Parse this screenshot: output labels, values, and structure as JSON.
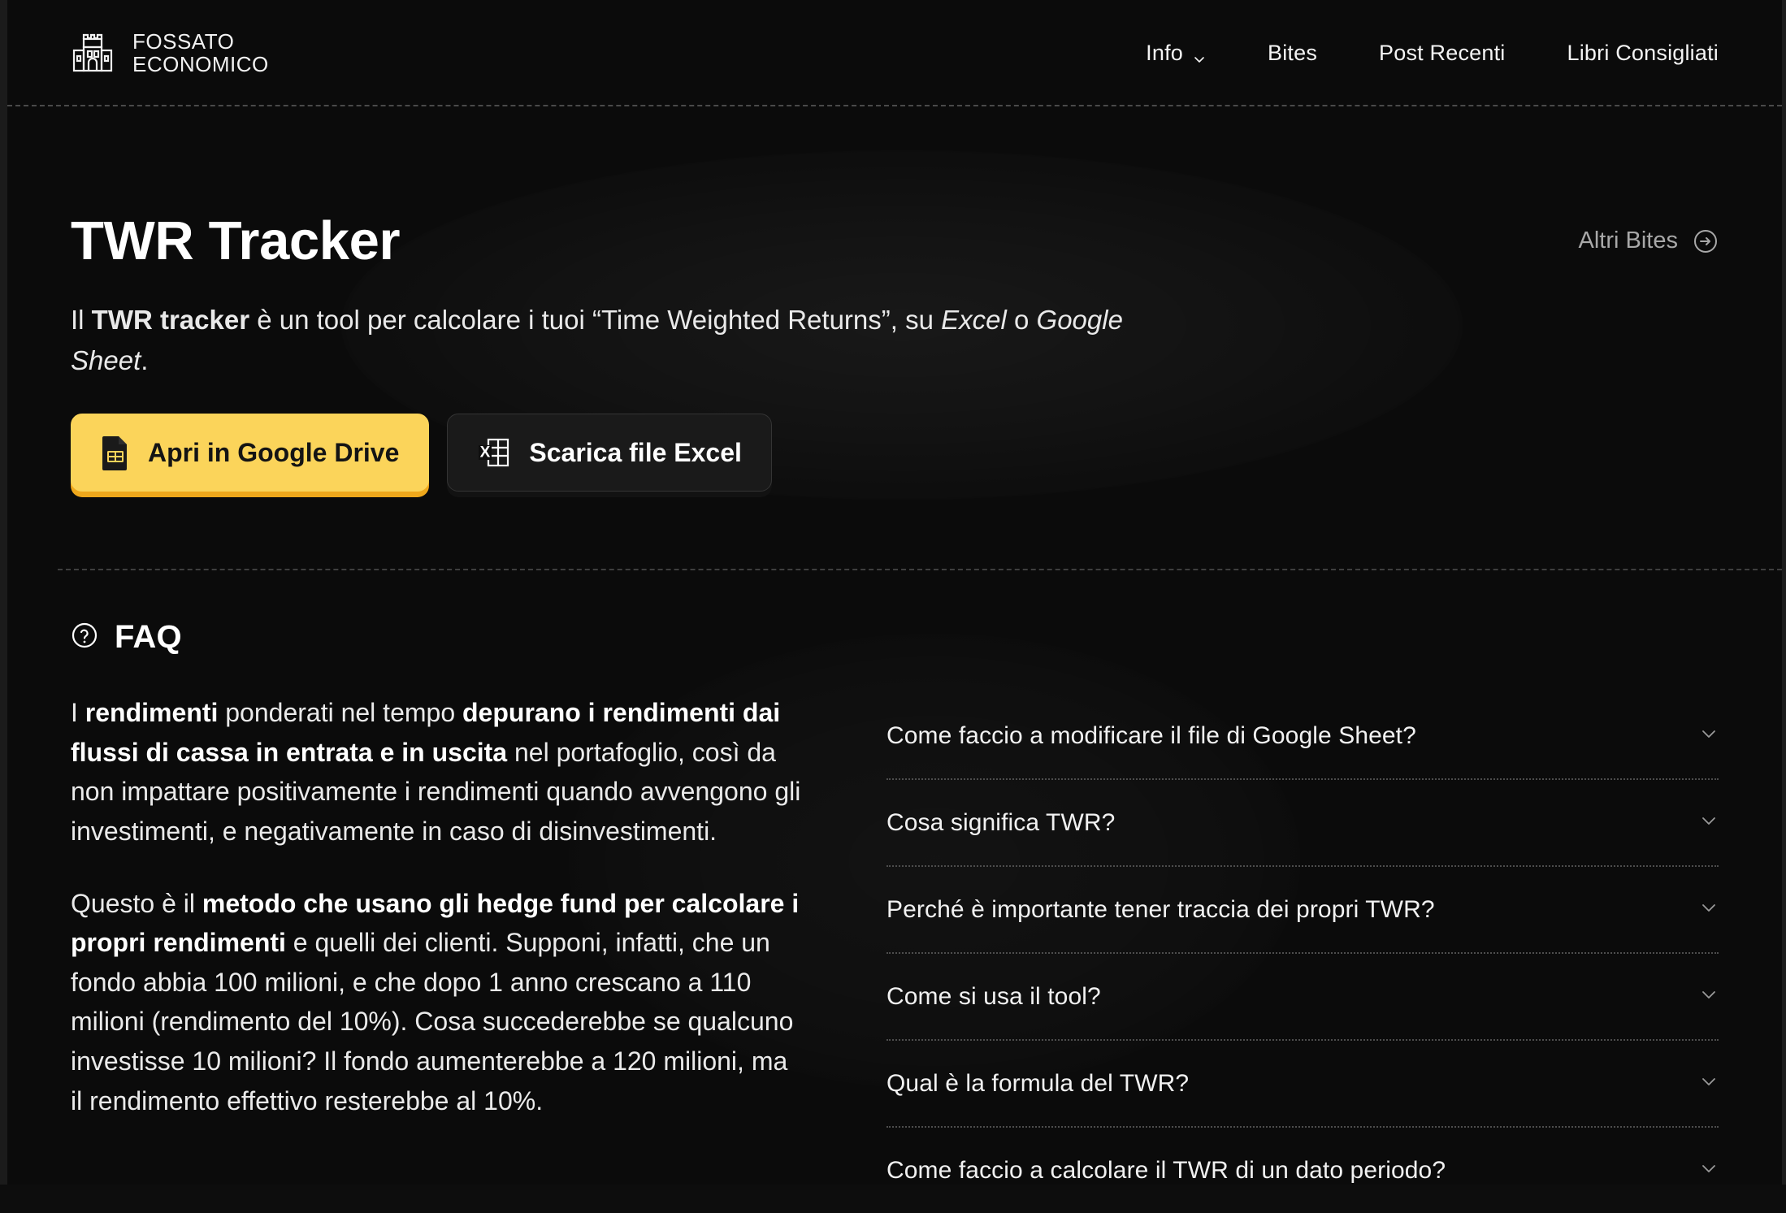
{
  "header": {
    "brand": {
      "line1": "FOSSATO",
      "line2": "ECONOMICO",
      "logo_icon": "castle-icon"
    },
    "nav": [
      {
        "label": "Info",
        "has_dropdown": true,
        "icon": "chevron-down-icon"
      },
      {
        "label": "Bites",
        "has_dropdown": false
      },
      {
        "label": "Post Recenti",
        "has_dropdown": false
      },
      {
        "label": "Libri Consigliati",
        "has_dropdown": false
      }
    ]
  },
  "hero": {
    "title": "TWR Tracker",
    "altri_bites": {
      "label": "Altri Bites",
      "icon": "arrow-right-circle-icon"
    },
    "description": {
      "part1": "Il ",
      "bold1": "TWR tracker",
      "part2": " è un tool per calcolare i tuoi “Time Weighted Returns”, su ",
      "italic1": "Excel",
      "part3": " o ",
      "italic2": "Google Sheet",
      "part4": "."
    },
    "buttons": [
      {
        "label": "Apri in Google Drive",
        "icon": "google-sheets-file-icon",
        "style": "primary-yellow"
      },
      {
        "label": "Scarica file Excel",
        "icon": "excel-file-icon",
        "style": "secondary-dark"
      }
    ]
  },
  "faq": {
    "heading": "FAQ",
    "heading_icon": "question-circle-icon",
    "paragraphs": [
      {
        "segments": [
          {
            "text": "I ",
            "bold": false
          },
          {
            "text": "rendimenti",
            "bold": true
          },
          {
            "text": " ponderati nel tempo ",
            "bold": false
          },
          {
            "text": "depurano i rendimenti dai flussi di cassa in entrata e in uscita",
            "bold": true
          },
          {
            "text": " nel portafoglio, così da non impattare positivamente i rendimenti quando avvengono gli investimenti, e negativamente in caso di disinvestimenti.",
            "bold": false
          }
        ]
      },
      {
        "segments": [
          {
            "text": "Questo è il ",
            "bold": false
          },
          {
            "text": "metodo che usano gli hedge fund per calcolare i propri rendimenti",
            "bold": true
          },
          {
            "text": " e quelli dei clienti. Supponi, infatti, che un fondo abbia 100 milioni, e che dopo 1 anno crescano a 110 milioni (rendimento del 10%). Cosa succederebbe se qualcuno investisse 10 milioni? Il fondo aumenterebbe a 120 milioni, ma il rendimento effettivo resterebbe al 10%.",
            "bold": false
          }
        ]
      }
    ],
    "items": [
      {
        "question": "Come faccio a modificare il file di Google Sheet?",
        "expanded": false,
        "icon": "chevron-down-icon"
      },
      {
        "question": "Cosa significa TWR?",
        "expanded": false,
        "icon": "chevron-down-icon"
      },
      {
        "question": "Perché è importante tener traccia dei propri TWR?",
        "expanded": false,
        "icon": "chevron-down-icon"
      },
      {
        "question": "Come si usa il tool?",
        "expanded": false,
        "icon": "chevron-down-icon"
      },
      {
        "question": "Qual è la formula del TWR?",
        "expanded": false,
        "icon": "chevron-down-icon"
      },
      {
        "question": "Come faccio a calcolare il TWR di un dato periodo?",
        "expanded": false,
        "icon": "chevron-down-icon"
      }
    ]
  },
  "colors": {
    "background": "#0b0b0b",
    "accent_yellow": "#fbd45a",
    "accent_yellow_shadow": "#efa81c",
    "text_primary": "#ffffff",
    "text_muted": "#a8a8a8",
    "divider": "#4a4a4a"
  }
}
